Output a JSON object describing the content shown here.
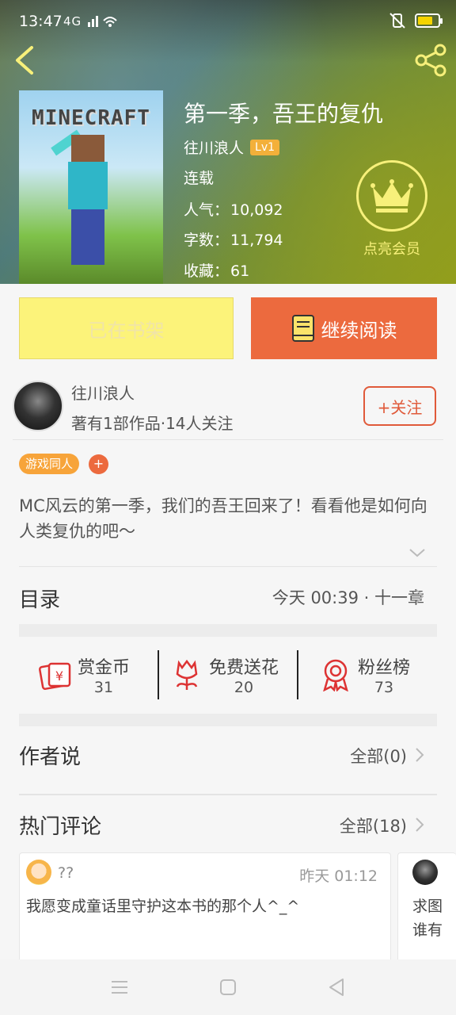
{
  "status_bar": {
    "time": "13:47",
    "signal": "4G"
  },
  "book": {
    "title": "第一季，吾王的复仇",
    "author": "往川浪人",
    "author_level": "Lv1",
    "status": "连载",
    "popularity_label": "人气：",
    "popularity": "10,092",
    "words_label": "字数：",
    "words": "11,794",
    "favorites_label": "收藏：",
    "favorites": "61",
    "cover_logo": "MINECRAFT"
  },
  "vip": {
    "label": "点亮会员"
  },
  "actions": {
    "shelf_label": "已在书架",
    "read_label": "继续阅读"
  },
  "author_card": {
    "name": "往川浪人",
    "works": "著有1部作品·14人关注",
    "follow_label": "+关注"
  },
  "tags": [
    {
      "label": "游戏同人"
    }
  ],
  "tag_add_label": "+",
  "description": "MC风云的第一季，我们的吾王回来了！看看他是如何向人类复仇的吧～",
  "catalog": {
    "title": "目录",
    "latest": "今天 00:39 · 十一章"
  },
  "stats": [
    {
      "label": "赏金币",
      "value": "31",
      "icon": "reward-coin-icon"
    },
    {
      "label": "免费送花",
      "value": "20",
      "icon": "flower-icon"
    },
    {
      "label": "粉丝榜",
      "value": "73",
      "icon": "ribbon-icon"
    }
  ],
  "author_says": {
    "title": "作者说",
    "all": "全部(0)"
  },
  "hot_comments": {
    "title": "热门评论",
    "all": "全部(18)",
    "items": [
      {
        "user": "??",
        "time": "昨天 01:12",
        "text": "我愿变成童话里守护这本书的那个人^_^"
      },
      {
        "user": "",
        "time": "",
        "text_line1": "求图",
        "text_line2": "谁有"
      }
    ]
  },
  "colors": {
    "accent": "#ec6a3e",
    "shelf_yellow": "#fcf37a",
    "vip_yellow": "#f7f07a",
    "tag_orange": "#f7a43a"
  }
}
